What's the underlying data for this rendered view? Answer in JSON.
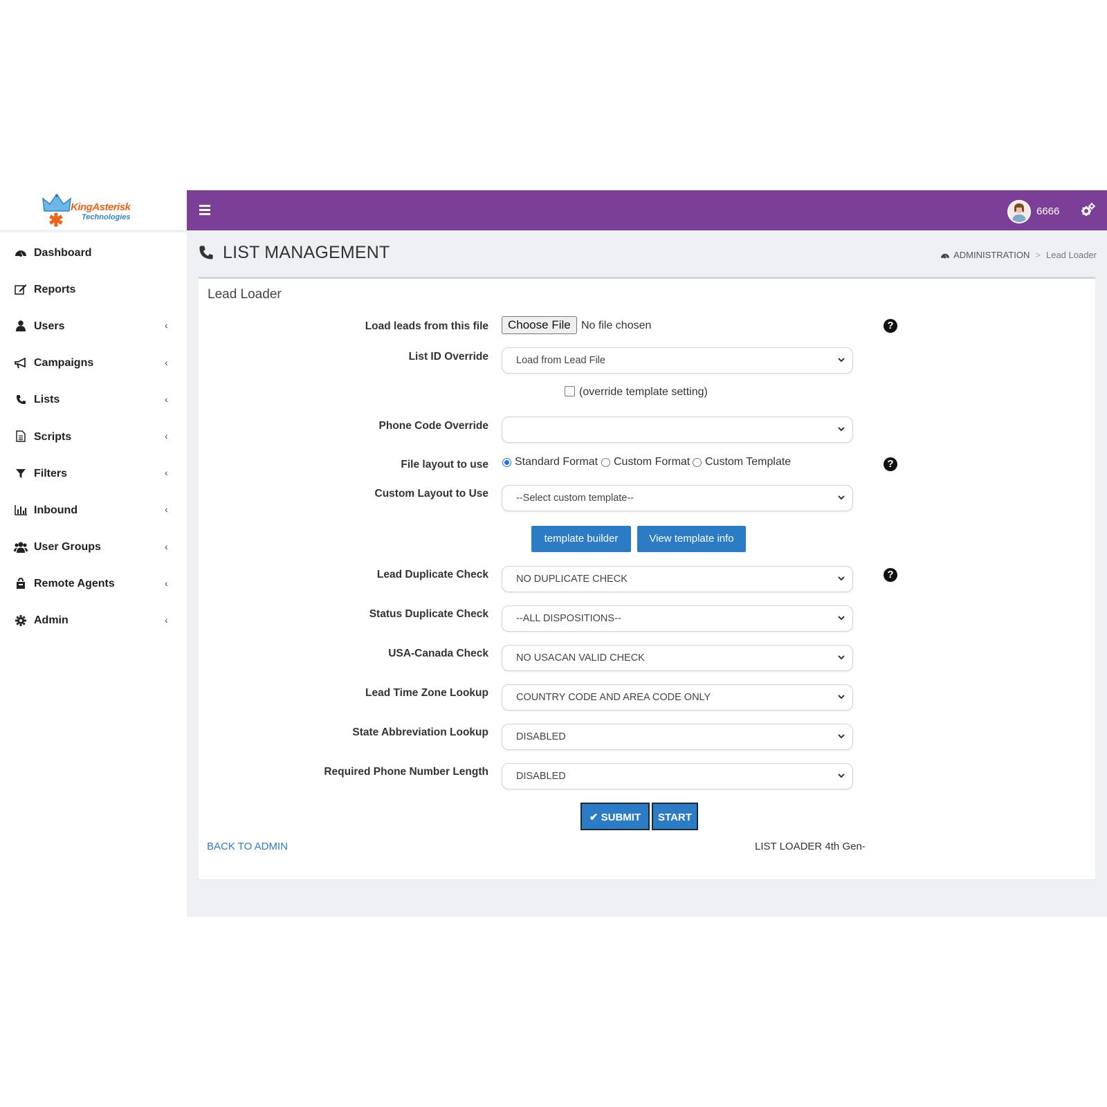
{
  "brand": {
    "logo_text_main": "KingAsterisk",
    "logo_text_sub": "Technologies"
  },
  "sidebar": {
    "items": [
      {
        "label": "Dashboard",
        "icon": "dashboard-icon"
      },
      {
        "label": "Reports",
        "icon": "edit-icon"
      },
      {
        "label": "Users",
        "icon": "user-icon"
      },
      {
        "label": "Campaigns",
        "icon": "bullhorn-icon"
      },
      {
        "label": "Lists",
        "icon": "phone-icon"
      },
      {
        "label": "Scripts",
        "icon": "document-icon"
      },
      {
        "label": "Filters",
        "icon": "filter-icon"
      },
      {
        "label": "Inbound",
        "icon": "bar-chart-icon"
      },
      {
        "label": "User Groups",
        "icon": "users-icon"
      },
      {
        "label": "Remote Agents",
        "icon": "remote-agent-icon"
      },
      {
        "label": "Admin",
        "icon": "gear-icon"
      }
    ]
  },
  "topbar": {
    "username": "6666",
    "bg_color": "#7b3f98"
  },
  "header": {
    "title": "LIST MANAGEMENT",
    "breadcrumb_root": "ADMINISTRATION",
    "breadcrumb_sep": ">",
    "breadcrumb_current": "Lead Loader"
  },
  "card": {
    "title": "Lead Loader"
  },
  "form": {
    "load_file_label": "Load leads from this file",
    "choose_file_button": "Choose File",
    "file_status": "No file chosen",
    "list_id_label": "List ID Override",
    "list_id_value": "Load from Lead File",
    "override_template_label": "(override template setting)",
    "phone_code_label": "Phone Code Override",
    "phone_code_value": "",
    "file_layout_label": "File layout to use",
    "layout_options": [
      "Standard Format",
      "Custom Format",
      "Custom Template"
    ],
    "layout_selected": "Standard Format",
    "custom_layout_label": "Custom Layout to Use",
    "custom_layout_value": "--Select custom template--",
    "template_builder_button": "template builder",
    "view_template_button": "View template info",
    "lead_dup_label": "Lead Duplicate Check",
    "lead_dup_value": "NO DUPLICATE CHECK",
    "status_dup_label": "Status Duplicate Check",
    "status_dup_value": "--ALL DISPOSITIONS--",
    "usa_canada_label": "USA-Canada Check",
    "usa_canada_value": "NO USACAN VALID CHECK",
    "timezone_label": "Lead Time Zone Lookup",
    "timezone_value": "COUNTRY CODE AND AREA CODE ONLY",
    "state_abbr_label": "State Abbreviation Lookup",
    "state_abbr_value": "DISABLED",
    "phone_len_label": "Required Phone Number Length",
    "phone_len_value": "DISABLED",
    "submit_button": "SUBMIT",
    "start_button": "START",
    "help_glyph": "?"
  },
  "footer": {
    "back_link": "BACK TO ADMIN",
    "version": "LIST LOADER 4th Gen-"
  }
}
